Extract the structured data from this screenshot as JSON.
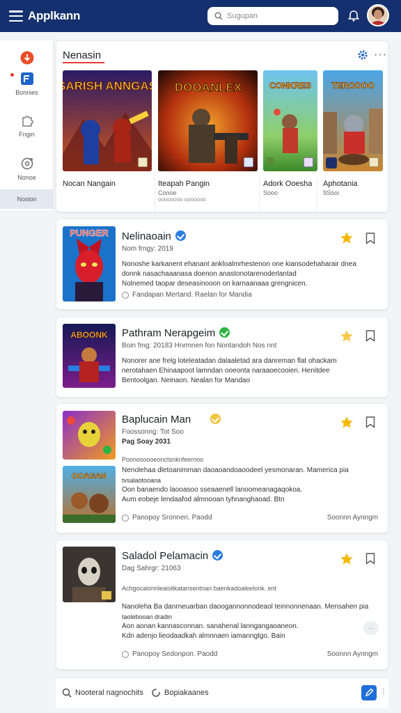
{
  "app": {
    "title": "Applkann"
  },
  "search": {
    "placeholder": "Sugupan"
  },
  "sidebar": {
    "items": [
      {
        "label": ""
      },
      {
        "label": "Bonnies"
      },
      {
        "label": "Fngin"
      },
      {
        "label": "Nonoe"
      },
      {
        "label": "Nosion"
      }
    ]
  },
  "featured": {
    "title": "Nenasin",
    "tiles": [
      {
        "name": "Nocan Nangain",
        "sub": "",
        "art_text": "SARISH ANNGAS"
      },
      {
        "name": "Iteapah Pangin",
        "sub": "Conoe",
        "sub2": "oooooooo ooooooo",
        "art_text": "DOOANLEX"
      },
      {
        "name": "Adork Ooesha",
        "sub": "Sooo",
        "art_text": "CONKRES"
      },
      {
        "name": "Aphotania",
        "sub": "9Sooi",
        "art_text": "TEROOOO"
      }
    ]
  },
  "games": [
    {
      "title": "Nelinaoain",
      "verified_color": "#2a7de1",
      "meta": "Nom frngy: 2019",
      "desc": [
        "Nonoshe karkanent ehanant ankloalmrhestenon one kiansodehaharair dnea",
        "donnk nasachaaanasa doenon anastonotarenoderlantad",
        "Nolnemed taopar deseasinooon on karnaanaaa grengnicen."
      ],
      "footer": "Fandapan  Mertand.  Raelan  for Mandia",
      "right": "",
      "art_text": "PUNGER"
    },
    {
      "title": "Pathram Nerapgeim",
      "verified_color": "#2fb344",
      "meta": "Boin fmg: 20183  Hnrmnen fon Nontandoh Nos  nnt",
      "desc": [
        "Nonorer ane frelg loteleatadan dalaaletad ara danreman flat ohackam",
        "nerotahaen Ehinaapoot lamndan ooeonta naraaoecooien. Henitdee",
        "Bentoolgan.  Neinaon.  Nealan  for Mandao"
      ],
      "footer": "",
      "right": "",
      "art_text": "ABOONK"
    },
    {
      "title": "Baplucain Man",
      "verified_color": "#f2c53d",
      "meta": "Foossonng: Tot Soo",
      "meta2": "Pag Soay 2031",
      "desc_head": "Poonosoooeonctsnknfeernoo",
      "desc": [
        "Nenolehaa dletoanimman daoaoandoaoodeel yesmonaran. Mamerica pia",
        "tvsalaotooana",
        "Oon banaendo laooasoo sseaaenell lanoomeanagaqokoa.",
        "Aum eobeje lendaafod almnooan tyhnanghaoad. Btn"
      ],
      "footer": "Panopoy  Sronnen. Paodd",
      "right": "Soonnn Aynngm",
      "art_text": "OOAGAN"
    },
    {
      "title": "Saladol Pelamacin",
      "verified_color": "#2a7de1",
      "meta": "Dag Sahrgr: 21063",
      "desc_head": "Achgocalonnleaisitkatansentnan baenkadoaleelonk.  ent",
      "desc": [
        "Nanoleha Ba danrneuarban daoogannonnodeaol teinnonnenaan. Mensahen pia",
        "taolebooan dradin",
        "Aon aonan kannasconnan. sanahenal lanngangaoaneon.",
        "Kdn adenjo lieodaadkah almnnaen iamanngtgo. Bain"
      ],
      "footer": "Panopoy  Sedonpon. Paodd",
      "right": "Soonnn Aynngm",
      "art_text": ""
    }
  ],
  "bottom": {
    "left_label": "Nooteral nagnochits",
    "mid_label": "Bopiakaanes"
  },
  "colors": {
    "topbar": "#14306e",
    "accent_red": "#e53935",
    "accent_blue": "#2a7de1",
    "star": "#f5b800"
  }
}
